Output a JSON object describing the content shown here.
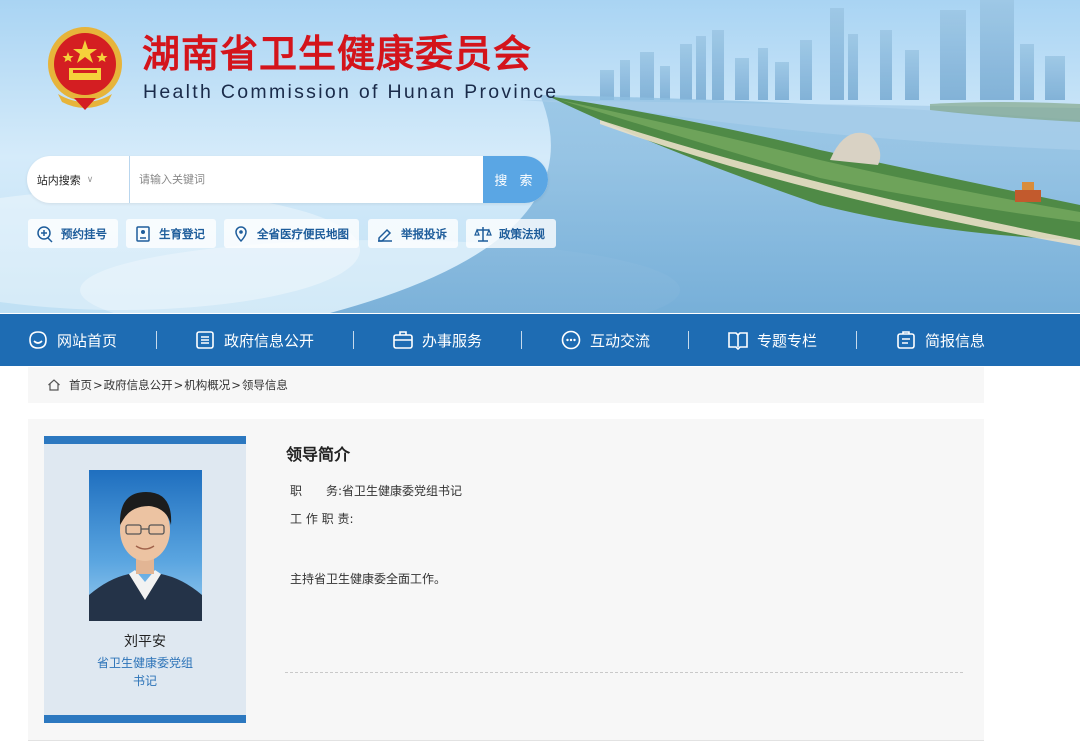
{
  "header": {
    "title_cn": "湖南省卫生健康委员会",
    "title_en": "Health Commission of Hunan Province",
    "emblem_icon": "national-emblem-icon",
    "brand_red": "#d4141b"
  },
  "search": {
    "scope_label": "站内搜索",
    "placeholder": "请输入关键词",
    "button_label": "搜 索"
  },
  "quick_links": [
    {
      "label": "预约挂号",
      "icon": "add-location-icon"
    },
    {
      "label": "生育登记",
      "icon": "registration-icon"
    },
    {
      "label": "全省医疗便民地图",
      "icon": "map-pin-icon"
    },
    {
      "label": "举报投诉",
      "icon": "pen-icon"
    },
    {
      "label": "政策法规",
      "icon": "scales-icon"
    }
  ],
  "nav": {
    "color": "#1e6cb3",
    "items": [
      {
        "label": "网站首页",
        "icon": "home-icon"
      },
      {
        "label": "政府信息公开",
        "icon": "document-list-icon"
      },
      {
        "label": "办事服务",
        "icon": "briefcase-icon"
      },
      {
        "label": "互动交流",
        "icon": "chat-icon"
      },
      {
        "label": "专题专栏",
        "icon": "book-icon"
      },
      {
        "label": "简报信息",
        "icon": "clipboard-icon"
      }
    ]
  },
  "breadcrumb": {
    "items": [
      "首页",
      "政府信息公开",
      "机构概况",
      "领导信息"
    ],
    "separator": ">"
  },
  "profile": {
    "name": "刘平安",
    "role_line1": "省卫生健康委党组",
    "role_line2": "书记",
    "section_title": "领导简介",
    "position_label": "职　　务:",
    "position_value": "省卫生健康委党组书记",
    "duty_label": "工 作 职 责:",
    "duty_text": "主持省卫生健康委全面工作。"
  }
}
